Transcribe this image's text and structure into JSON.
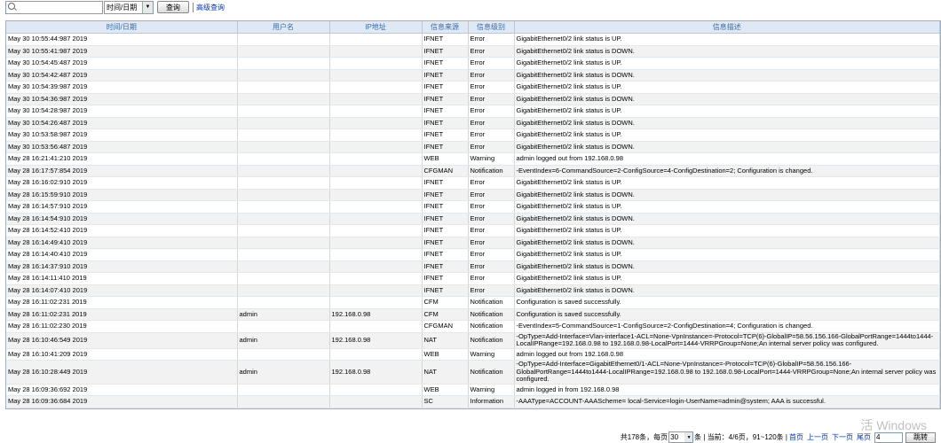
{
  "toolbar": {
    "search_placeholder": "",
    "select_value": "时间/日期",
    "query_label": "查询",
    "advanced_link": "高级查询"
  },
  "columns": [
    "时间/日期",
    "用户名",
    "IP地址",
    "信息来源",
    "信息级别",
    "信息描述"
  ],
  "rows": [
    {
      "time": "May 30 10:55:44:987 2019",
      "user": "",
      "ip": "",
      "source": "IFNET",
      "level": "Error",
      "desc": "GigabitEthernet0/2 link status is UP."
    },
    {
      "time": "May 30 10:55:41:987 2019",
      "user": "",
      "ip": "",
      "source": "IFNET",
      "level": "Error",
      "desc": "GigabitEthernet0/2 link status is DOWN."
    },
    {
      "time": "May 30 10:54:45:487 2019",
      "user": "",
      "ip": "",
      "source": "IFNET",
      "level": "Error",
      "desc": "GigabitEthernet0/2 link status is UP."
    },
    {
      "time": "May 30 10:54:42:487 2019",
      "user": "",
      "ip": "",
      "source": "IFNET",
      "level": "Error",
      "desc": "GigabitEthernet0/2 link status is DOWN."
    },
    {
      "time": "May 30 10:54:39:987 2019",
      "user": "",
      "ip": "",
      "source": "IFNET",
      "level": "Error",
      "desc": "GigabitEthernet0/2 link status is UP."
    },
    {
      "time": "May 30 10:54:36:987 2019",
      "user": "",
      "ip": "",
      "source": "IFNET",
      "level": "Error",
      "desc": "GigabitEthernet0/2 link status is DOWN."
    },
    {
      "time": "May 30 10:54:28:987 2019",
      "user": "",
      "ip": "",
      "source": "IFNET",
      "level": "Error",
      "desc": "GigabitEthernet0/2 link status is UP."
    },
    {
      "time": "May 30 10:54:26:487 2019",
      "user": "",
      "ip": "",
      "source": "IFNET",
      "level": "Error",
      "desc": "GigabitEthernet0/2 link status is DOWN."
    },
    {
      "time": "May 30 10:53:58:987 2019",
      "user": "",
      "ip": "",
      "source": "IFNET",
      "level": "Error",
      "desc": "GigabitEthernet0/2 link status is UP."
    },
    {
      "time": "May 30 10:53:56:487 2019",
      "user": "",
      "ip": "",
      "source": "IFNET",
      "level": "Error",
      "desc": "GigabitEthernet0/2 link status is DOWN."
    },
    {
      "time": "May 28 16:21:41:210 2019",
      "user": "",
      "ip": "",
      "source": "WEB",
      "level": "Warning",
      "desc": "admin logged out from 192.168.0.98"
    },
    {
      "time": "May 28 16:17:57:854 2019",
      "user": "",
      "ip": "",
      "source": "CFGMAN",
      "level": "Notification",
      "desc": "-EventIndex=6-CommandSource=2-ConfigSource=4-ConfigDestination=2; Configuration is changed."
    },
    {
      "time": "May 28 16:16:02:910 2019",
      "user": "",
      "ip": "",
      "source": "IFNET",
      "level": "Error",
      "desc": "GigabitEthernet0/2 link status is UP."
    },
    {
      "time": "May 28 16:15:59:910 2019",
      "user": "",
      "ip": "",
      "source": "IFNET",
      "level": "Error",
      "desc": "GigabitEthernet0/2 link status is DOWN."
    },
    {
      "time": "May 28 16:14:57:910 2019",
      "user": "",
      "ip": "",
      "source": "IFNET",
      "level": "Error",
      "desc": "GigabitEthernet0/2 link status is UP."
    },
    {
      "time": "May 28 16:14:54:910 2019",
      "user": "",
      "ip": "",
      "source": "IFNET",
      "level": "Error",
      "desc": "GigabitEthernet0/2 link status is DOWN."
    },
    {
      "time": "May 28 16:14:52:410 2019",
      "user": "",
      "ip": "",
      "source": "IFNET",
      "level": "Error",
      "desc": "GigabitEthernet0/2 link status is UP."
    },
    {
      "time": "May 28 16:14:49:410 2019",
      "user": "",
      "ip": "",
      "source": "IFNET",
      "level": "Error",
      "desc": "GigabitEthernet0/2 link status is DOWN."
    },
    {
      "time": "May 28 16:14:40:410 2019",
      "user": "",
      "ip": "",
      "source": "IFNET",
      "level": "Error",
      "desc": "GigabitEthernet0/2 link status is UP."
    },
    {
      "time": "May 28 16:14:37:910 2019",
      "user": "",
      "ip": "",
      "source": "IFNET",
      "level": "Error",
      "desc": "GigabitEthernet0/2 link status is DOWN."
    },
    {
      "time": "May 28 16:14:11:410 2019",
      "user": "",
      "ip": "",
      "source": "IFNET",
      "level": "Error",
      "desc": "GigabitEthernet0/2 link status is UP."
    },
    {
      "time": "May 28 16:14:07:410 2019",
      "user": "",
      "ip": "",
      "source": "IFNET",
      "level": "Error",
      "desc": "GigabitEthernet0/2 link status is DOWN."
    },
    {
      "time": "May 28 16:11:02:231 2019",
      "user": "",
      "ip": "",
      "source": "CFM",
      "level": "Notification",
      "desc": "Configuration is saved successfully."
    },
    {
      "time": "May 28 16:11:02:231 2019",
      "user": "admin",
      "ip": "192.168.0.98",
      "source": "CFM",
      "level": "Notification",
      "desc": "Configuration is saved successfully."
    },
    {
      "time": "May 28 16:11:02:230 2019",
      "user": "",
      "ip": "",
      "source": "CFGMAN",
      "level": "Notification",
      "desc": "-EventIndex=5-CommandSource=1-ConfigSource=2-ConfigDestination=4; Configuration is changed."
    },
    {
      "time": "May 28 16:10:46:549 2019",
      "user": "admin",
      "ip": "192.168.0.98",
      "source": "NAT",
      "level": "Notification",
      "desc": "-OpType=Add-Interface=Vlan-interface1-ACL=None-VpnInstance=-Protocol=TCP(6)-GlobalIP=58.56.156.166-GlobalPortRange=1444to1444-LocalIPRange=192.168.0.98 to 192.168.0.98-LocalPort=1444-VRRPGroup=None;An internal server policy was configured."
    },
    {
      "time": "May 28 16:10:41:209 2019",
      "user": "",
      "ip": "",
      "source": "WEB",
      "level": "Warning",
      "desc": "admin logged out from 192.168.0.98"
    },
    {
      "time": "May 28 16:10:28:449 2019",
      "user": "admin",
      "ip": "192.168.0.98",
      "source": "NAT",
      "level": "Notification",
      "desc": "-OpType=Add-Interface=GigabitEthernet0/1-ACL=None-VpnInstance=-Protocol=TCP(6)-GlobalIP=58.56.156.166-GlobalPortRange=1444to1444-LocalIPRange=192.168.0.98 to 192.168.0.98-LocalPort=1444-VRRPGroup=None;An internal server policy was configured."
    },
    {
      "time": "May 28 16:09:36:692 2019",
      "user": "",
      "ip": "",
      "source": "WEB",
      "level": "Warning",
      "desc": "admin logged in from 192.168.0.98"
    },
    {
      "time": "May 28 16:09:36:684 2019",
      "user": "",
      "ip": "",
      "source": "SC",
      "level": "Information",
      "desc": "-AAAType=ACCOUNT-AAAScheme= local-Service=login-UserName=admin@system; AAA is successful."
    }
  ],
  "pager": {
    "total": "共178条，每页",
    "per_page": "30",
    "suffix": "条 | 当前：4/6页，91~120条 |",
    "first": "首页",
    "prev": "上一页",
    "next": "下一页",
    "last": "尾页",
    "page_input": "4",
    "go": "跳转"
  },
  "watermark": "活 Windows"
}
